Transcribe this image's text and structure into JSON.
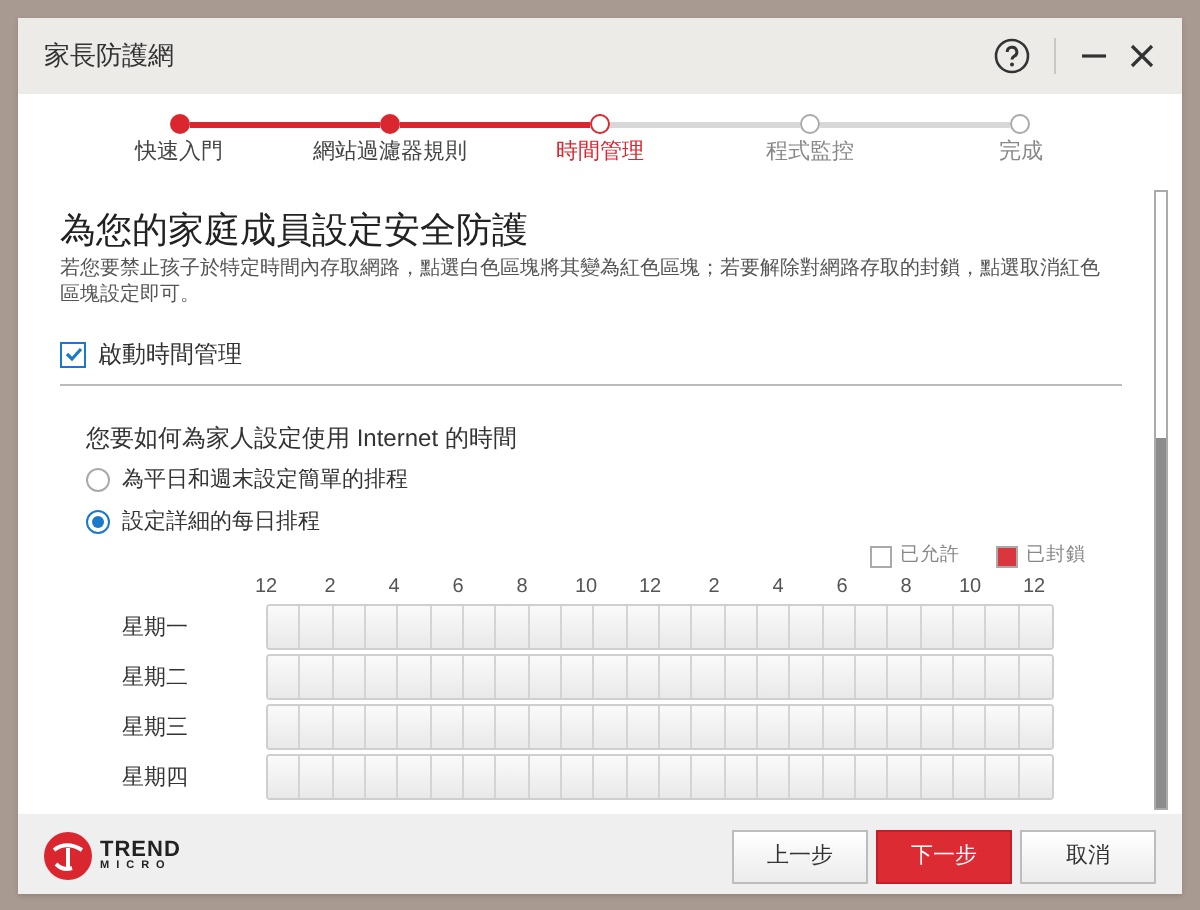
{
  "window": {
    "title": "家長防護網"
  },
  "steps": [
    {
      "label": "快速入門",
      "completed": true,
      "selected": false
    },
    {
      "label": "網站過濾器規則",
      "completed": true,
      "selected": false
    },
    {
      "label": "時間管理",
      "completed": false,
      "selected": true
    },
    {
      "label": "程式監控",
      "completed": false,
      "selected": false
    },
    {
      "label": "完成",
      "completed": false,
      "selected": false
    }
  ],
  "heading": "為您的家庭成員設定安全防護",
  "description": "若您要禁止孩子於特定時間內存取網路，點選白色區塊將其變為紅色區塊；若要解除對網路存取的封鎖，點選取消紅色區塊設定即可。",
  "enable": {
    "label": "啟動時間管理",
    "checked": true
  },
  "question": "您要如何為家人設定使用 Internet 的時間",
  "options": [
    {
      "label": "為平日和週末設定簡單的排程",
      "selected": false
    },
    {
      "label": "設定詳細的每日排程",
      "selected": true
    }
  ],
  "legend": [
    {
      "label": "已允許",
      "color": "#ffffff"
    },
    {
      "label": "已封鎖",
      "color": "#d9363e"
    }
  ],
  "hours": [
    "12",
    "2",
    "4",
    "6",
    "8",
    "10",
    "12",
    "2",
    "4",
    "6",
    "8",
    "10",
    "12"
  ],
  "days": [
    "星期一",
    "星期二",
    "星期三",
    "星期四"
  ],
  "logo": {
    "line1": "TREND",
    "line2": "MICRO"
  },
  "buttons": [
    {
      "label": "上一步",
      "kind": "normal"
    },
    {
      "label": "下一步",
      "kind": "primary"
    },
    {
      "label": "取消",
      "kind": "normal"
    }
  ]
}
